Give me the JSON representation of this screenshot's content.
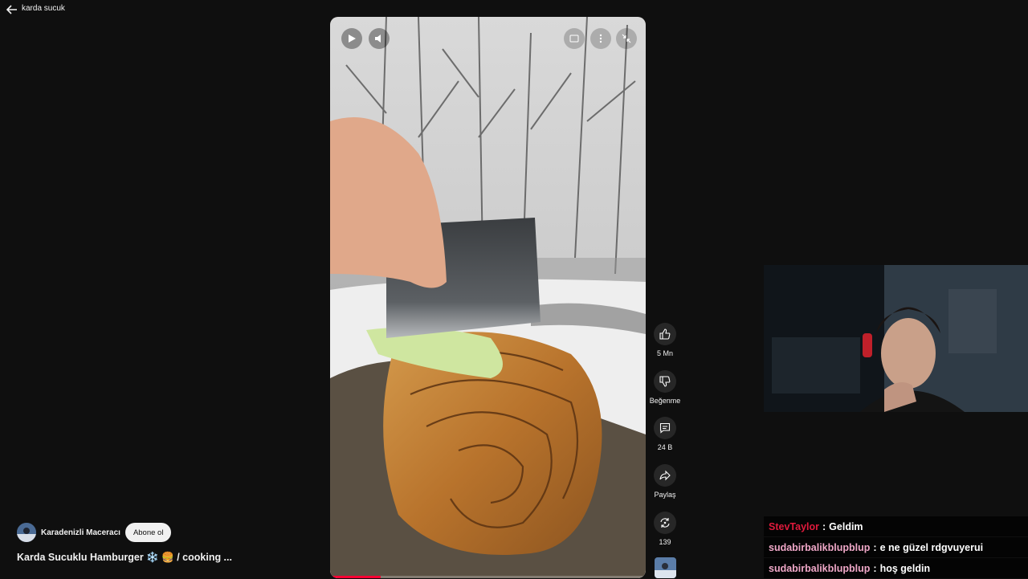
{
  "search": {
    "query": "karda sucuk"
  },
  "actions": {
    "like_count": "5 Mn",
    "dislike_label": "Beğenme",
    "comment_count": "24 B",
    "share_label": "Paylaş",
    "remix_count": "139"
  },
  "video": {
    "progress_fraction": 0.16
  },
  "channel": {
    "name": "Karadenizli Maceracı",
    "subscribe_label": "Abone ol"
  },
  "short_title": "Karda Sucuklu Hamburger ❄️ 🍔 / cooking ...",
  "chat": {
    "separator": ":",
    "messages": [
      {
        "user": "StevTaylor",
        "text": "Geldim",
        "color": "#e01a3c"
      },
      {
        "user": "sudabirbalikblupblup",
        "text": "e ne güzel rdgvuyerui",
        "color": "#f0a8c8"
      },
      {
        "user": "sudabirbalikblupblup",
        "text": "hoş geldin",
        "color": "#f0a8c8"
      }
    ]
  },
  "colors": {
    "background": "#0f0f0f",
    "accent": "#ff0033",
    "action_button": "#272727"
  }
}
